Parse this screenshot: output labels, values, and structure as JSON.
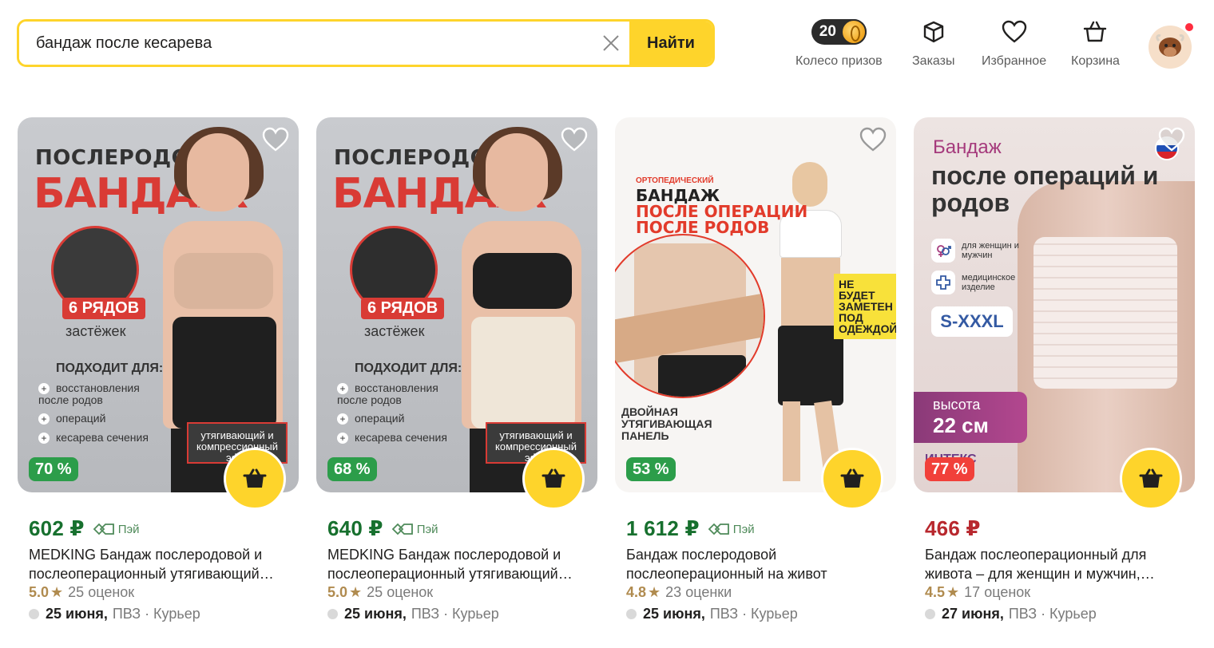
{
  "header": {
    "search": {
      "value": "бандаж после кесарева",
      "button_label": "Найти"
    },
    "prize_wheel": {
      "count": "20",
      "label": "Колесо призов"
    },
    "orders_label": "Заказы",
    "favorites_label": "Избранное",
    "cart_label": "Корзина"
  },
  "colors": {
    "accent_yellow": "#fed42b",
    "price_green": "#17702e",
    "price_red": "#b8282e",
    "discount_green": "#2c9d4a",
    "discount_red": "#f1403a"
  },
  "products": [
    {
      "image_text": {
        "line1": "ПОСЛЕРОДОВОЙ",
        "line2": "БАНДАЖ",
        "badge": "6 РЯДОВ",
        "badge_sub": "застёжек",
        "fits": "ПОДХОДИТ ДЛЯ:",
        "bullets": [
          "восстановления после родов",
          "операций",
          "кесарева сечения"
        ],
        "callout": "утягивающий и компрессионный эфф"
      },
      "discount": "70 %",
      "price": "602 ₽",
      "pay_label": "Пэй",
      "title": "MEDKING Бандаж послеродовой и послеоперационный утягивающий…",
      "rating": "5.0",
      "reviews": "25 оценок",
      "delivery_date": "25 июня,",
      "delivery_methods": "ПВЗ · Курьер"
    },
    {
      "image_text": {
        "line1": "ПОСЛЕРОДОВОЙ",
        "line2": "БАНДАЖ",
        "badge": "6 РЯДОВ",
        "badge_sub": "застёжек",
        "fits": "ПОДХОДИТ ДЛЯ:",
        "bullets": [
          "восстановления после родов",
          "операций",
          "кесарева сечения"
        ],
        "callout": "утягивающий и компрессионный эфф"
      },
      "discount": "68 %",
      "price": "640 ₽",
      "pay_label": "Пэй",
      "title": "MEDKING Бандаж послеродовой и послеоперационный утягивающий…",
      "rating": "5.0",
      "reviews": "25 оценок",
      "delivery_date": "25 июня,",
      "delivery_methods": "ПВЗ · Курьер"
    },
    {
      "image_text": {
        "small": "ОРТОПЕДИЧЕСКИЙ",
        "line1": "БАНДАЖ",
        "line2": "ПОСЛЕ ОПЕРАЦИИ",
        "line3": "ПОСЛЕ РОДОВ",
        "note": "НЕ БУДЕТ ЗАМЕТЕН ПОД ОДЕЖДОЙ",
        "bottom": "ДВОЙНАЯ УТЯГИВАЮЩАЯ ПАНЕЛЬ"
      },
      "discount": "53 %",
      "price": "1 612 ₽",
      "pay_label": "Пэй",
      "title": "Бандаж послеродовой послеоперационный на живот",
      "rating": "4.8",
      "reviews": "23 оценки",
      "delivery_date": "25 июня,",
      "delivery_methods": "ПВЗ · Курьер"
    },
    {
      "image_text": {
        "line1": "Бандаж",
        "line2": "после операций и родов",
        "feature1": "для женщин и мужчин",
        "feature2": "медицинское изделие",
        "size": "S-XXXL",
        "height_label": "высота",
        "height_value": "22 см",
        "brand": "ИНТЕКС"
      },
      "discount": "77 %",
      "price": "466 ₽",
      "pay_label": "",
      "title": "Бандаж послеоперационный для живота – для женщин и мужчин,…",
      "rating": "4.5",
      "reviews": "17 оценок",
      "delivery_date": "27 июня,",
      "delivery_methods": "ПВЗ · Курьер"
    }
  ]
}
